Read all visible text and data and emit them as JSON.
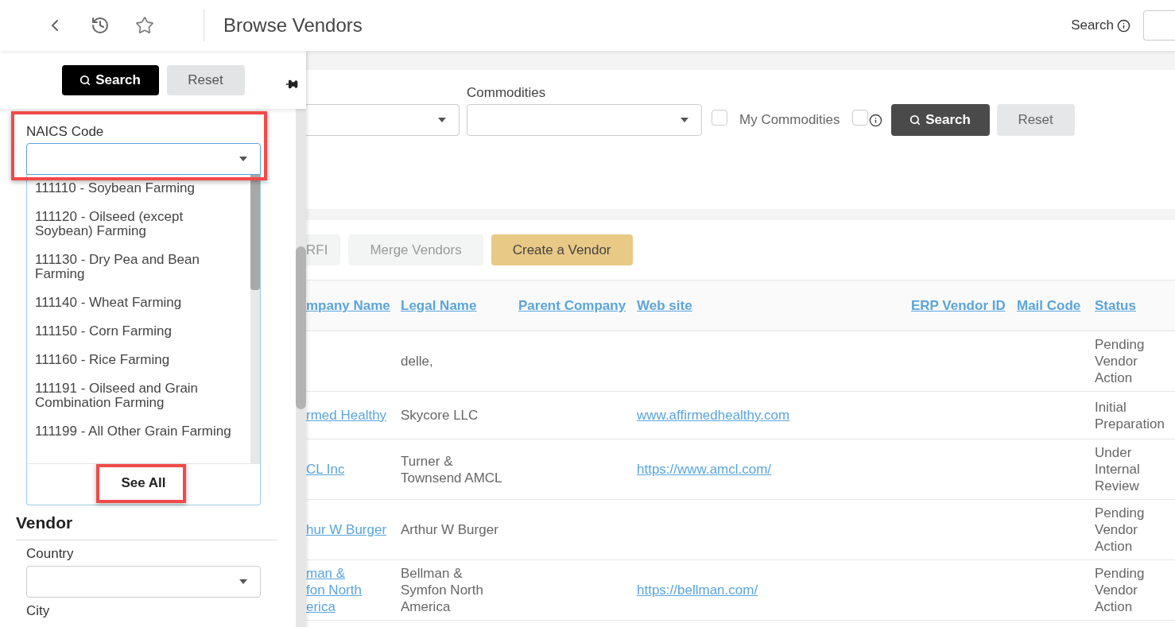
{
  "topbar": {
    "title": "Browse Vendors",
    "search_label": "Search"
  },
  "filter_panel": {
    "search_button": "Search",
    "reset_button": "Reset",
    "naics": {
      "label": "NAICS Code",
      "expanded": true,
      "highlighted": true,
      "options": [
        "111110 - Soybean Farming",
        "111120 - Oilseed (except Soybean) Farming",
        "111130 - Dry Pea and Bean Farming",
        "111140 - Wheat Farming",
        "111150 - Corn Farming",
        "111160 - Rice Farming",
        "111191 - Oilseed and Grain Combination Farming",
        "111199 - All Other Grain Farming"
      ],
      "see_all": {
        "label": "See All",
        "highlighted": true
      }
    },
    "vendor_section": {
      "heading": "Vendor",
      "fields": [
        {
          "label": "Country",
          "kind": "select"
        },
        {
          "label": "City",
          "kind": "label"
        }
      ]
    }
  },
  "filters": {
    "commodities_label": "Commodities",
    "my_commodities": {
      "label": "My Commodities",
      "checked": false
    },
    "info_checkbox": {
      "checked": false
    },
    "search_button": "Search",
    "reset_button": "Reset"
  },
  "actions": [
    {
      "label": "RFI",
      "kind": "disabled"
    },
    {
      "label": "Merge Vendors",
      "kind": "disabled"
    },
    {
      "label": "Create a Vendor",
      "kind": "primary"
    }
  ],
  "table": {
    "columns": [
      "mpany Name",
      "Legal Name",
      "Parent Company",
      "Web site",
      "ERP Vendor ID",
      "Mail Code",
      "Status"
    ],
    "rows": [
      {
        "company_name": "",
        "legal_name": "delle,",
        "web_site": "",
        "status": "Pending Vendor Action"
      },
      {
        "company_name": "rmed Healthy",
        "legal_name": "Skycore LLC",
        "web_site": "www.affirmedhealthy.com",
        "status": "Initial Preparation"
      },
      {
        "company_name": "CL Inc",
        "legal_name": "Turner &\nTownsend AMCL",
        "web_site": "https://www.amcl.com/",
        "status": "Under Internal Review"
      },
      {
        "company_name": "hur W Burger",
        "legal_name": "Arthur W Burger",
        "web_site": "",
        "status": "Pending Vendor Action"
      },
      {
        "company_name": "man &\nfon North\nerica",
        "legal_name": "Bellman &\nSymfon North\nAmerica",
        "web_site": "https://bellman.com/",
        "status": "Pending Vendor Action"
      }
    ]
  }
}
